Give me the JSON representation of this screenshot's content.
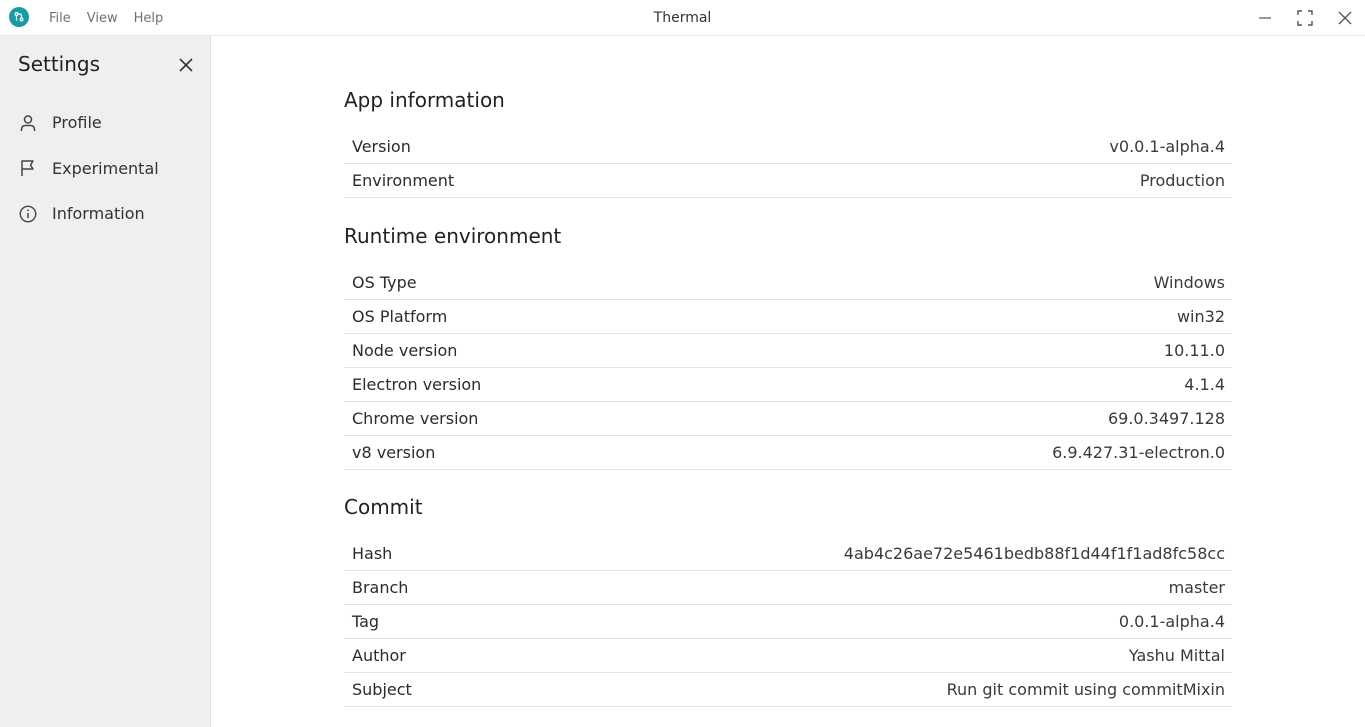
{
  "window": {
    "title": "Thermal",
    "menu": [
      "File",
      "View",
      "Help"
    ]
  },
  "sidebar": {
    "title": "Settings",
    "items": [
      {
        "label": "Profile",
        "icon": "user-icon"
      },
      {
        "label": "Experimental",
        "icon": "flag-icon"
      },
      {
        "label": "Information",
        "icon": "info-icon"
      }
    ]
  },
  "sections": [
    {
      "title": "App information",
      "rows": [
        {
          "label": "Version",
          "value": "v0.0.1-alpha.4"
        },
        {
          "label": "Environment",
          "value": "Production"
        }
      ]
    },
    {
      "title": "Runtime environment",
      "rows": [
        {
          "label": "OS Type",
          "value": "Windows"
        },
        {
          "label": "OS Platform",
          "value": "win32"
        },
        {
          "label": "Node version",
          "value": "10.11.0"
        },
        {
          "label": "Electron version",
          "value": "4.1.4"
        },
        {
          "label": "Chrome version",
          "value": "69.0.3497.128"
        },
        {
          "label": "v8 version",
          "value": "6.9.427.31-electron.0"
        }
      ]
    },
    {
      "title": "Commit",
      "rows": [
        {
          "label": "Hash",
          "value": "4ab4c26ae72e5461bedb88f1d44f1f1ad8fc58cc"
        },
        {
          "label": "Branch",
          "value": "master"
        },
        {
          "label": "Tag",
          "value": "0.0.1-alpha.4"
        },
        {
          "label": "Author",
          "value": "Yashu Mittal"
        },
        {
          "label": "Subject",
          "value": "Run git commit using commitMixin"
        }
      ]
    }
  ],
  "colors": {
    "accent": "#1a9ba1",
    "sidebar_bg": "#efefef",
    "divider": "#e4e4e4"
  }
}
